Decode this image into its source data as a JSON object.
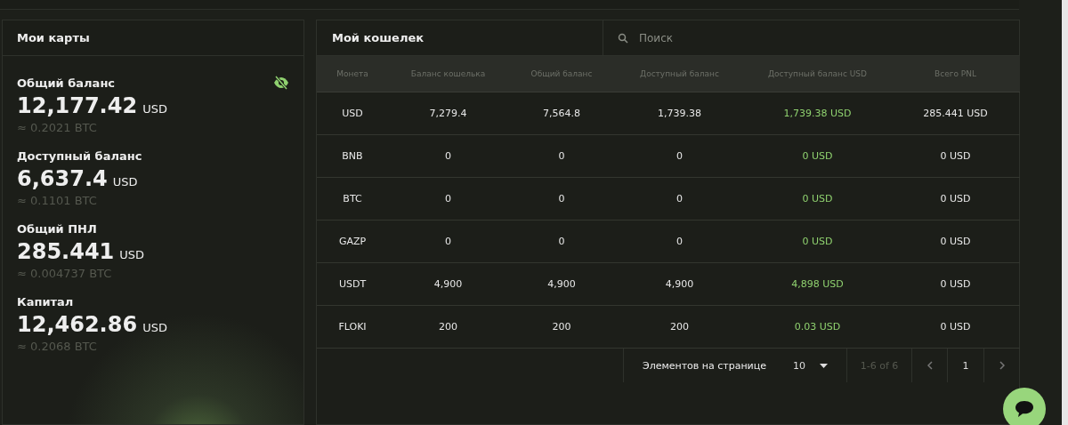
{
  "cards": {
    "title": "Мои карты",
    "balances": [
      {
        "label": "Общий баланс",
        "amount": "12,177.42",
        "currency": "USD",
        "btc": "≈ 0.2021 BTC"
      },
      {
        "label": "Доступный баланс",
        "amount": "6,637.4",
        "currency": "USD",
        "btc": "≈ 0.1101 BTC"
      },
      {
        "label": "Общий ПНЛ",
        "amount": "285.441",
        "currency": "USD",
        "btc": "≈ 0.004737 BTC"
      },
      {
        "label": "Капитал",
        "amount": "12,462.86",
        "currency": "USD",
        "btc": "≈ 0.2068 BTC"
      }
    ]
  },
  "wallet": {
    "title": "Мой кошелек",
    "search": {
      "placeholder": "Поиск"
    },
    "table": {
      "columns": [
        "Монета",
        "Баланс кошелька",
        "Общий баланс",
        "Доступный баланс",
        "Доступный баланс USD",
        "Всего PNL"
      ],
      "rows": [
        [
          "USD",
          "7,279.4",
          "7,564.8",
          "1,739.38",
          "1,739.38 USD",
          "285.441 USD"
        ],
        [
          "BNB",
          "0",
          "0",
          "0",
          "0 USD",
          "0 USD"
        ],
        [
          "BTC",
          "0",
          "0",
          "0",
          "0 USD",
          "0 USD"
        ],
        [
          "GAZP",
          "0",
          "0",
          "0",
          "0 USD",
          "0 USD"
        ],
        [
          "USDT",
          "4,900",
          "4,900",
          "4,900",
          "4,898 USD",
          "0 USD"
        ],
        [
          "FLOKI",
          "200",
          "200",
          "200",
          "0.03 USD",
          "0 USD"
        ]
      ]
    },
    "pagination": {
      "per_page_label": "Элементов на странице",
      "per_page": "10",
      "range": "1-6 of 6",
      "page": "1"
    }
  }
}
